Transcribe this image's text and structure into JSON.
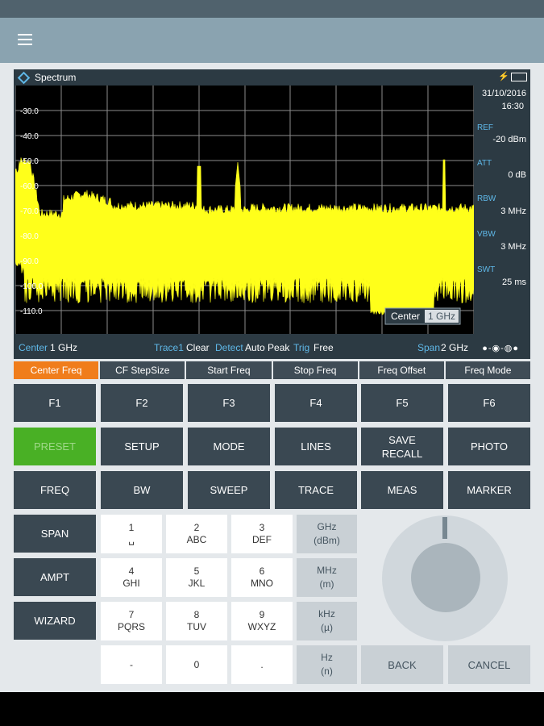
{
  "instrument": {
    "title": "Spectrum",
    "date": "31/10/2016",
    "time": "16:30",
    "ref_label": "REF",
    "ref_value": "-20 dBm",
    "att_label": "ATT",
    "att_value": "0 dB",
    "rbw_label": "RBW",
    "rbw_value": "3 MHz",
    "vbw_label": "VBW",
    "vbw_value": "3 MHz",
    "swt_label": "SWT",
    "swt_value": "25 ms",
    "y_ticks": [
      "-30.0",
      "-40.0",
      "-50.0",
      "-60.0",
      "-70.0",
      "-80.0",
      "-90.0",
      "-100.0",
      "-110.0"
    ],
    "marker_label": "Center",
    "marker_value": "1 GHz",
    "footer": {
      "center_label": "Center",
      "center_value": "1 GHz",
      "trace_label": "Trace1",
      "trace_value": "Clear",
      "detect_label": "Detect",
      "detect_value": "Auto Peak",
      "trig_label": "Trig",
      "trig_value": "Free",
      "span_label": "Span",
      "span_value": "2 GHz"
    },
    "colors": {
      "trace": "#ffff1a",
      "accent": "#5fb8e8",
      "active_tab": "#f07d1b",
      "preset": "#49b025"
    }
  },
  "softkeys": [
    "Center Freq",
    "CF StepSize",
    "Start Freq",
    "Stop Freq",
    "Freq Offset",
    "Freq Mode"
  ],
  "fkeys": [
    "F1",
    "F2",
    "F3",
    "F4",
    "F5",
    "F6"
  ],
  "row2": [
    "PRESET",
    "SETUP",
    "MODE",
    "LINES",
    "SAVE\nRECALL",
    "PHOTO"
  ],
  "row3": [
    "FREQ",
    "BW",
    "SWEEP",
    "TRACE",
    "MEAS",
    "MARKER"
  ],
  "left_keys": [
    "SPAN",
    "AMPT",
    "WIZARD"
  ],
  "numpad": [
    {
      "digit": "1",
      "letters": "␣"
    },
    {
      "digit": "2",
      "letters": "ABC"
    },
    {
      "digit": "3",
      "letters": "DEF"
    },
    {
      "digit": "4",
      "letters": "GHI"
    },
    {
      "digit": "5",
      "letters": "JKL"
    },
    {
      "digit": "6",
      "letters": "MNO"
    },
    {
      "digit": "7",
      "letters": "PQRS"
    },
    {
      "digit": "8",
      "letters": "TUV"
    },
    {
      "digit": "9",
      "letters": "WXYZ"
    },
    {
      "digit": "-",
      "letters": ""
    },
    {
      "digit": "0",
      "letters": ""
    },
    {
      "digit": ".",
      "letters": ""
    }
  ],
  "units": [
    "GHz\n(dBm)",
    "MHz\n(m)",
    "kHz\n(µ)",
    "Hz\n(n)"
  ],
  "back_label": "BACK",
  "cancel_label": "CANCEL",
  "icons": {
    "menu": "hamburger-icon",
    "charging": "bolt-icon",
    "battery": "battery-icon"
  }
}
